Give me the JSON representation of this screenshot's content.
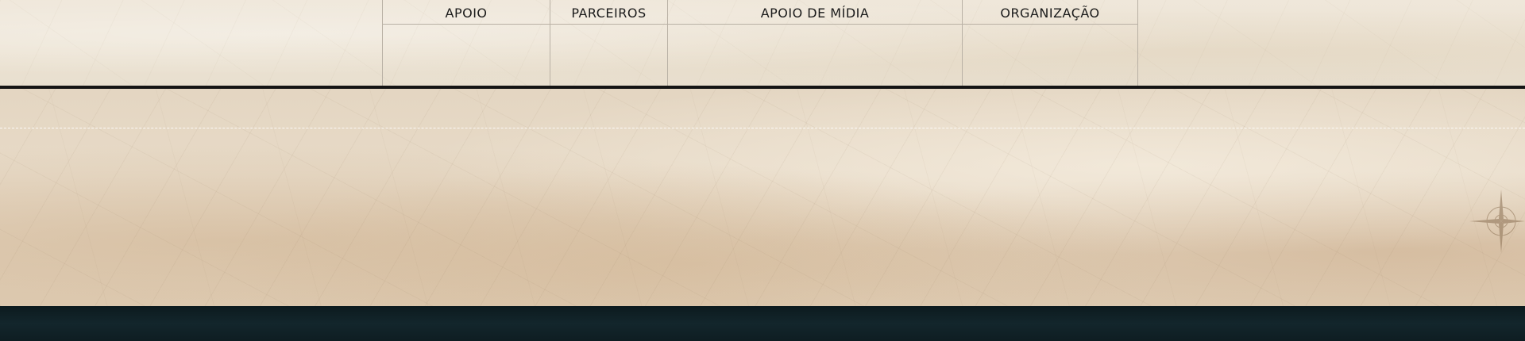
{
  "sponsors": {
    "columns": [
      {
        "label": "APOIO"
      },
      {
        "label": "PARCEIROS"
      },
      {
        "label": "APOIO DE MÍDIA"
      },
      {
        "label": "ORGANIZAÇÃO"
      }
    ]
  },
  "colors": {
    "parchment": "#ece3d3",
    "divider": "#141414",
    "footer": "#0f1b1f"
  },
  "icons": {
    "map_decoration": "compass-rose-icon"
  }
}
